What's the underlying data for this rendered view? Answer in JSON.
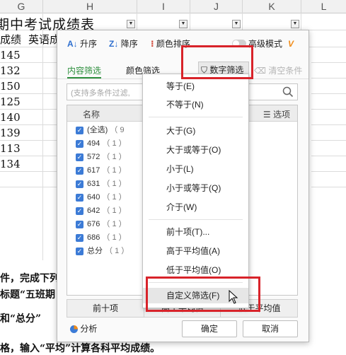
{
  "sheet": {
    "columns": [
      "G",
      "H",
      "I",
      "J",
      "K",
      "L"
    ],
    "title_fragment": "期中考试成绩表",
    "header_cells": [
      "成绩",
      "英语成"
    ],
    "score_values": [
      "145",
      "132",
      "150",
      "125",
      "140",
      "139",
      "113",
      "134"
    ],
    "doc_lines": [
      "件，完成下列",
      "标题“五班期",
      "和“总分”",
      "格，输入“平均”计算各科平均成绩。"
    ]
  },
  "dialog": {
    "sort_asc": "升序",
    "sort_desc": "降序",
    "color_sort": "颜色排序",
    "advanced_mode": "高级模式",
    "vip_badge": "V",
    "tab_content": "内容筛选",
    "tab_color": "颜色筛选",
    "tab_number": "数字筛选",
    "clear_conditions": "清空条件",
    "search_placeholder": "(支持多条件过滤,",
    "list_header_name": "名称",
    "list_header_options": "选项",
    "list_items": [
      {
        "label": "(全选)",
        "count": "（ 9"
      },
      {
        "label": "494",
        "count": "（ 1 ）"
      },
      {
        "label": "572",
        "count": "（ 1 ）"
      },
      {
        "label": "617",
        "count": "（ 1 ）"
      },
      {
        "label": "631",
        "count": "（ 1 ）"
      },
      {
        "label": "640",
        "count": "（ 1 ）"
      },
      {
        "label": "642",
        "count": "（ 1 ）"
      },
      {
        "label": "676",
        "count": "（ 1 ）"
      },
      {
        "label": "686",
        "count": "（ 1 ）"
      },
      {
        "label": "总分",
        "count": "（ 1 ）"
      }
    ],
    "bottom_tabs": [
      "前十项",
      "高于平均值",
      "低于平均值"
    ],
    "analysis": "分析",
    "ok": "确定",
    "cancel": "取消"
  },
  "menu": {
    "items": [
      "等于(E)",
      "不等于(N)",
      "大于(G)",
      "大于或等于(O)",
      "小于(L)",
      "小于或等于(Q)",
      "介于(W)",
      "前十项(T)...",
      "高于平均值(A)",
      "低于平均值(O)",
      "自定义筛选(F)"
    ]
  },
  "colors": {
    "highlight_red": "#d8232a",
    "accent_green": "#2e8f3e",
    "checkbox_blue": "#3c7bd6",
    "vip_orange": "#f08c1a"
  }
}
